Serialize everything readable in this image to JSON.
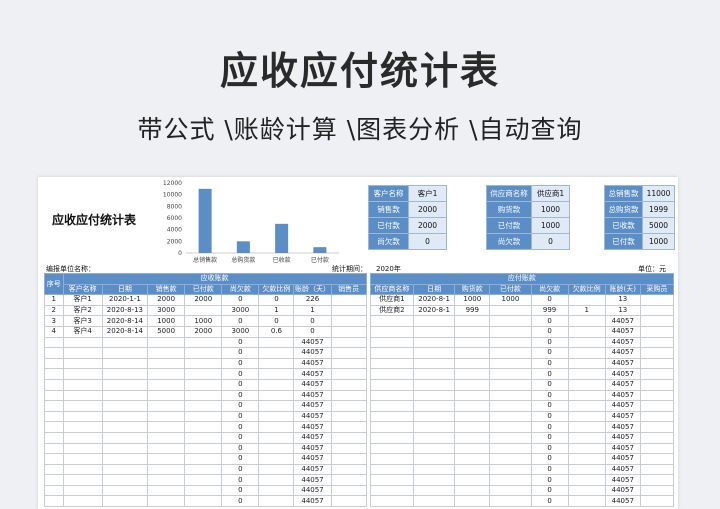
{
  "hero": {
    "title": "应收应付统计表",
    "subtitle": "带公式 \\账龄计算 \\图表分析 \\自动查询"
  },
  "sheet": {
    "title": "应收应付统计表",
    "company_label": "编报单位名称：",
    "period_label": "统计期间：",
    "period_value": "2020年",
    "unit_label": "单位：元"
  },
  "chart_data": {
    "type": "bar",
    "categories": [
      "总销售款",
      "总购货款",
      "已收款",
      "已付款"
    ],
    "values": [
      11000,
      1999,
      5000,
      1000
    ],
    "ylim": [
      0,
      12000
    ],
    "yticks": [
      0,
      2000,
      4000,
      6000,
      8000,
      10000,
      12000
    ],
    "bar_color": "#5b8dc6"
  },
  "customer_box": [
    {
      "k": "客户名称",
      "v": "客户1"
    },
    {
      "k": "销售款",
      "v": "2000"
    },
    {
      "k": "已付款",
      "v": "2000"
    },
    {
      "k": "尚欠款",
      "v": "0"
    }
  ],
  "supplier_box": [
    {
      "k": "供应商名称",
      "v": "供应商1"
    },
    {
      "k": "购货款",
      "v": "1000"
    },
    {
      "k": "已付款",
      "v": "1000"
    },
    {
      "k": "尚欠款",
      "v": "0"
    }
  ],
  "summary_box": [
    {
      "k": "总销售款",
      "v": "11000"
    },
    {
      "k": "总购货款",
      "v": "1999"
    },
    {
      "k": "已收款",
      "v": "5000"
    },
    {
      "k": "已付款",
      "v": "1000"
    }
  ],
  "table": {
    "seq_header": "序号",
    "recv_group": "应收账款",
    "pay_group": "应付账款",
    "recv_headers": [
      "客户名称",
      "日期",
      "销售款",
      "已付款",
      "尚欠款",
      "欠款比例",
      "账龄（天）",
      "销售员"
    ],
    "pay_headers": [
      "供应商名称",
      "日期",
      "购货款",
      "已付款",
      "尚欠款",
      "欠款比例",
      "账龄(天)",
      "采购员"
    ],
    "recv_rows": [
      [
        "1",
        "客户1",
        "2020-1-1",
        "2000",
        "2000",
        "0",
        "0",
        "226",
        ""
      ],
      [
        "2",
        "客户2",
        "2020-8-13",
        "3000",
        "",
        "3000",
        "1",
        "1",
        ""
      ],
      [
        "3",
        "客户3",
        "2020-8-14",
        "1000",
        "1000",
        "0",
        "0",
        "0",
        ""
      ],
      [
        "4",
        "客户4",
        "2020-8-14",
        "5000",
        "2000",
        "3000",
        "0.6",
        "0",
        ""
      ],
      [
        "",
        "",
        "",
        "",
        "",
        "0",
        "",
        "44057",
        ""
      ],
      [
        "",
        "",
        "",
        "",
        "",
        "0",
        "",
        "44057",
        ""
      ],
      [
        "",
        "",
        "",
        "",
        "",
        "0",
        "",
        "44057",
        ""
      ],
      [
        "",
        "",
        "",
        "",
        "",
        "0",
        "",
        "44057",
        ""
      ],
      [
        "",
        "",
        "",
        "",
        "",
        "0",
        "",
        "44057",
        ""
      ],
      [
        "",
        "",
        "",
        "",
        "",
        "0",
        "",
        "44057",
        ""
      ],
      [
        "",
        "",
        "",
        "",
        "",
        "0",
        "",
        "44057",
        ""
      ],
      [
        "",
        "",
        "",
        "",
        "",
        "0",
        "",
        "44057",
        ""
      ],
      [
        "",
        "",
        "",
        "",
        "",
        "0",
        "",
        "44057",
        ""
      ],
      [
        "",
        "",
        "",
        "",
        "",
        "0",
        "",
        "44057",
        ""
      ],
      [
        "",
        "",
        "",
        "",
        "",
        "0",
        "",
        "44057",
        ""
      ],
      [
        "",
        "",
        "",
        "",
        "",
        "0",
        "",
        "44057",
        ""
      ],
      [
        "",
        "",
        "",
        "",
        "",
        "0",
        "",
        "44057",
        ""
      ],
      [
        "",
        "",
        "",
        "",
        "",
        "0",
        "",
        "44057",
        ""
      ],
      [
        "",
        "",
        "",
        "",
        "",
        "0",
        "",
        "44057",
        ""
      ],
      [
        "",
        "",
        "",
        "",
        "",
        "0",
        "",
        "44057",
        ""
      ]
    ],
    "pay_rows": [
      [
        "供应商1",
        "2020-8-1",
        "1000",
        "1000",
        "0",
        "",
        "13",
        ""
      ],
      [
        "供应商2",
        "2020-8-1",
        "999",
        "",
        "999",
        "1",
        "13",
        ""
      ],
      [
        "",
        "",
        "",
        "",
        "0",
        "",
        "44057",
        ""
      ],
      [
        "",
        "",
        "",
        "",
        "0",
        "",
        "44057",
        ""
      ],
      [
        "",
        "",
        "",
        "",
        "0",
        "",
        "44057",
        ""
      ],
      [
        "",
        "",
        "",
        "",
        "0",
        "",
        "44057",
        ""
      ],
      [
        "",
        "",
        "",
        "",
        "0",
        "",
        "44057",
        ""
      ],
      [
        "",
        "",
        "",
        "",
        "0",
        "",
        "44057",
        ""
      ],
      [
        "",
        "",
        "",
        "",
        "0",
        "",
        "44057",
        ""
      ],
      [
        "",
        "",
        "",
        "",
        "0",
        "",
        "44057",
        ""
      ],
      [
        "",
        "",
        "",
        "",
        "0",
        "",
        "44057",
        ""
      ],
      [
        "",
        "",
        "",
        "",
        "0",
        "",
        "44057",
        ""
      ],
      [
        "",
        "",
        "",
        "",
        "0",
        "",
        "44057",
        ""
      ],
      [
        "",
        "",
        "",
        "",
        "0",
        "",
        "44057",
        ""
      ],
      [
        "",
        "",
        "",
        "",
        "0",
        "",
        "44057",
        ""
      ],
      [
        "",
        "",
        "",
        "",
        "0",
        "",
        "44057",
        ""
      ],
      [
        "",
        "",
        "",
        "",
        "0",
        "",
        "44057",
        ""
      ],
      [
        "",
        "",
        "",
        "",
        "0",
        "",
        "44057",
        ""
      ],
      [
        "",
        "",
        "",
        "",
        "0",
        "",
        "44057",
        ""
      ],
      [
        "",
        "",
        "",
        "",
        "0",
        "",
        "44057",
        ""
      ]
    ]
  }
}
